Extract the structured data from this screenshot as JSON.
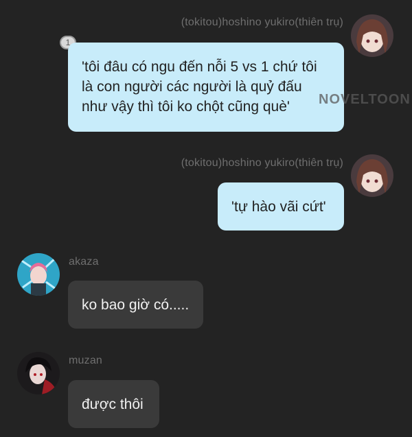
{
  "messages": [
    {
      "sender": "(tokitou)hoshino yukiro(thiên trụ)",
      "text": "'tôi đâu có ngu đến nỗi 5 vs 1 chứ tôi là con người các người là quỷ đấu như vậy thì tôi ko chột cũng què'",
      "badge": "1"
    },
    {
      "sender": "(tokitou)hoshino yukiro(thiên trụ)",
      "text": "'tự hào vãi cứt'"
    },
    {
      "sender": "akaza",
      "text": "ko bao giờ có....."
    },
    {
      "sender": "muzan",
      "text": "được thôi"
    }
  ],
  "watermark": "NOVELTOON",
  "colors": {
    "background": "#232323",
    "my_bubble": "#c8ecfa",
    "other_bubble": "#3a3a3a"
  }
}
